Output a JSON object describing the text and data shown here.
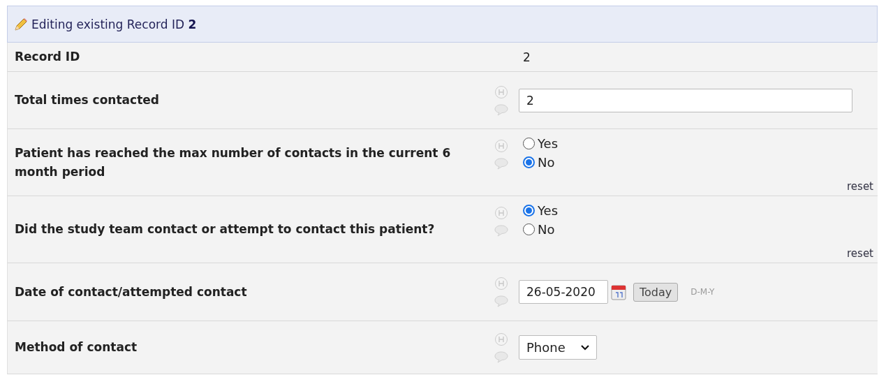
{
  "header": {
    "title": "Editing existing Record ID ",
    "record_id": "2"
  },
  "fields": [
    {
      "kind": "display",
      "label": "Record ID",
      "value": "2"
    },
    {
      "kind": "text",
      "label": "Total times contacted",
      "value": "2"
    },
    {
      "kind": "radio",
      "label": "Patient has reached the max number of contacts in the current 6 month period",
      "options": [
        {
          "label": "Yes",
          "selected": false
        },
        {
          "label": "No",
          "selected": true
        }
      ],
      "reset": "reset"
    },
    {
      "kind": "radio",
      "label": "Did the study team contact or attempt to contact this patient?",
      "options": [
        {
          "label": "Yes",
          "selected": true
        },
        {
          "label": "No",
          "selected": false
        }
      ],
      "reset": "reset"
    },
    {
      "kind": "date",
      "label": "Date of contact/attempted contact",
      "value": "26-05-2020",
      "button": "Today",
      "format": "D-M-Y"
    },
    {
      "kind": "select",
      "label": "Method of contact",
      "value": "Phone"
    }
  ]
}
